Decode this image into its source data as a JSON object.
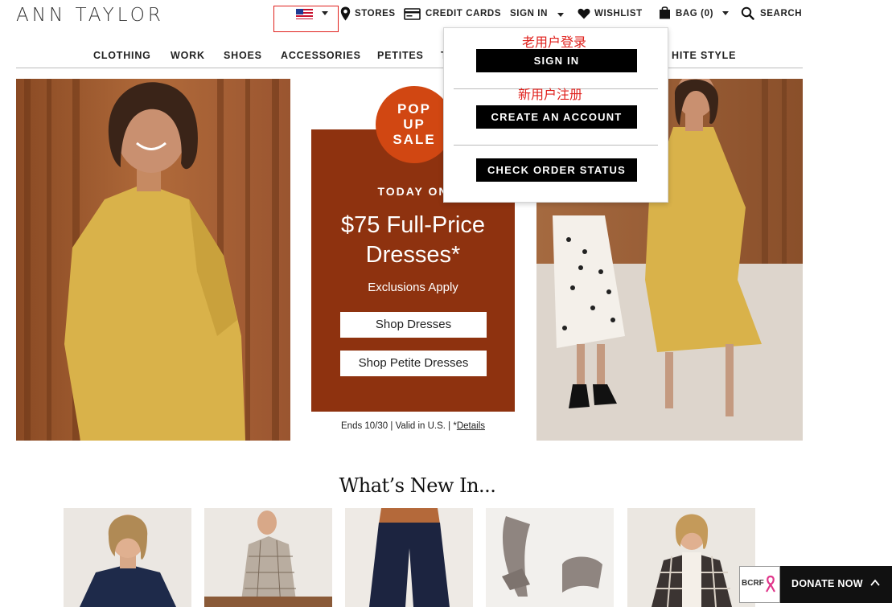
{
  "brand": {
    "logo": "ANN TAYLOR"
  },
  "header": {
    "country_flag": "us-flag-icon",
    "stores": "STORES",
    "credit_cards": "CREDIT CARDS",
    "sign_in": "SIGN IN",
    "wishlist": "WISHLIST",
    "bag": "BAG (0)",
    "search": "SEARCH"
  },
  "nav": {
    "items": [
      "CLOTHING",
      "WORK",
      "SHOES",
      "ACCESSORIES",
      "PETITES",
      "T",
      "HITE STYLE"
    ]
  },
  "promo": {
    "badge_lines": [
      "POP",
      "UP",
      "SALE"
    ],
    "today": "TODAY ON",
    "headline_line1": "$75 Full-Price",
    "headline_line2": "Dresses*",
    "exclusions": "Exclusions Apply",
    "shop_dresses": "Shop Dresses",
    "shop_petite": "Shop Petite Dresses",
    "ends_text": "Ends 10/30 | Valid in U.S. | *",
    "details_link": "Details"
  },
  "account_dropdown": {
    "annotation_existing": "老用户登录",
    "sign_in_button": "SIGN IN",
    "annotation_new": "新用户注册",
    "create_account_button": "CREATE AN ACCOUNT",
    "check_order_button": "CHECK ORDER STATUS"
  },
  "whats_new": {
    "title": "What’s New In..."
  },
  "donate": {
    "badge": "BCRF",
    "label": "DONATE NOW"
  },
  "colors": {
    "promo_panel": "#8e320f",
    "pop_badge": "#d14712",
    "annotation_red": "#e0201c",
    "dress_yellow": "#d9b24a"
  }
}
